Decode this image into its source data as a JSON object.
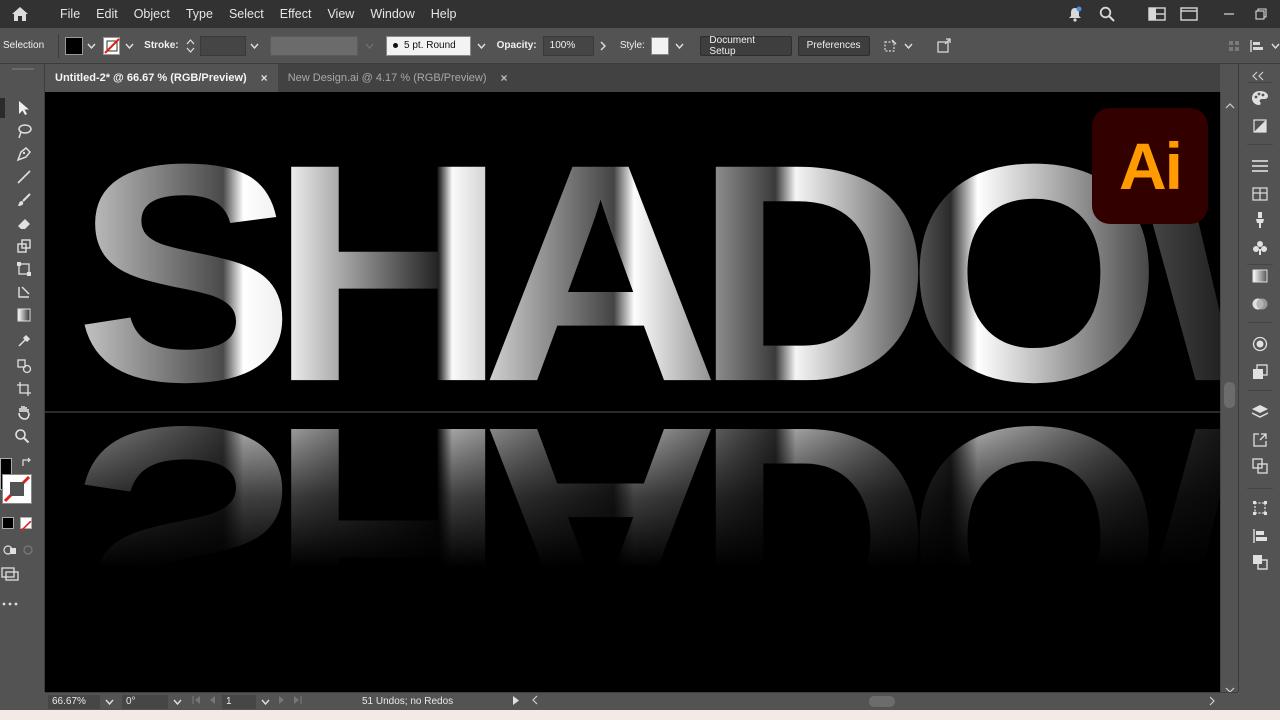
{
  "menu": {
    "items": [
      "File",
      "Edit",
      "Object",
      "Type",
      "Select",
      "Effect",
      "View",
      "Window",
      "Help"
    ]
  },
  "control": {
    "selection_label": "Selection",
    "stroke_label": "Stroke:",
    "brush_value": "5 pt. Round",
    "opacity_label": "Opacity:",
    "opacity_value": "100%",
    "style_label": "Style:",
    "document_setup": "Document Setup",
    "preferences": "Preferences"
  },
  "tabs": [
    {
      "label": "Untitled-2* @ 66.67 % (RGB/Preview)",
      "active": true
    },
    {
      "label": "New Design.ai @ 4.17 % (RGB/Preview)",
      "active": false
    }
  ],
  "artwork": {
    "word": "SHADOW",
    "logo_text": "Ai",
    "logo_bg": "#330000",
    "logo_fg": "#ff9a00"
  },
  "status": {
    "zoom": "66.67%",
    "rotation": "0°",
    "artboard": "1",
    "undo_text": "51 Undos; no Redos"
  },
  "colors": {
    "chrome_dark": "#323232",
    "chrome_mid": "#535353",
    "canvas": "#000000"
  }
}
